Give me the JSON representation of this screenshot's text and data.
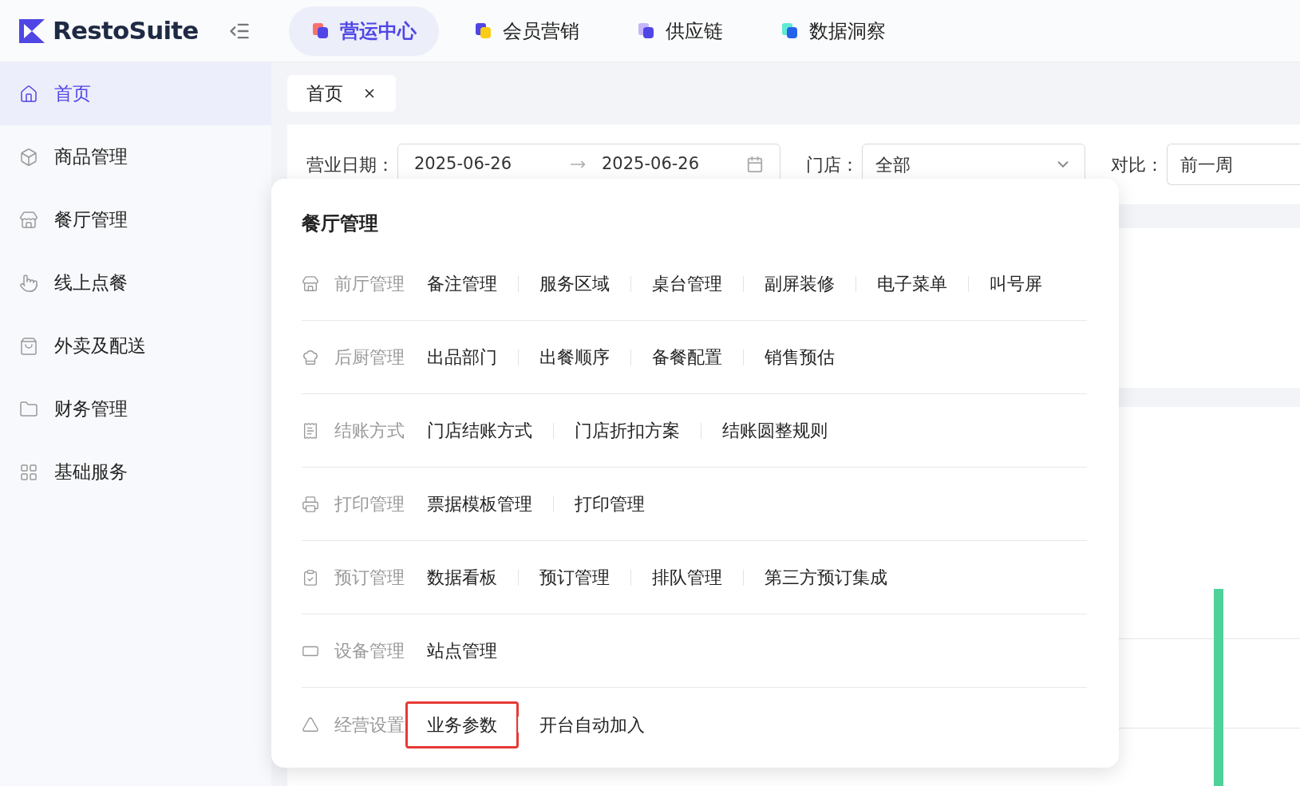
{
  "brand": {
    "name": "RestoSuite"
  },
  "top_nav": [
    {
      "label": "营运中心",
      "selected": true
    },
    {
      "label": "会员营销",
      "selected": false
    },
    {
      "label": "供应链",
      "selected": false
    },
    {
      "label": "数据洞察",
      "selected": false
    }
  ],
  "sidebar": {
    "items": [
      {
        "label": "首页",
        "selected": true
      },
      {
        "label": "商品管理",
        "selected": false
      },
      {
        "label": "餐厅管理",
        "selected": false
      },
      {
        "label": "线上点餐",
        "selected": false
      },
      {
        "label": "外卖及配送",
        "selected": false
      },
      {
        "label": "财务管理",
        "selected": false
      },
      {
        "label": "基础服务",
        "selected": false
      }
    ]
  },
  "page_tabs": [
    {
      "label": "首页",
      "selected": true
    }
  ],
  "filters": [
    {
      "kind": "daterange",
      "label": "营业日期：",
      "start": "2025-06-26",
      "end": "2025-06-26"
    },
    {
      "kind": "select",
      "label": "门店：",
      "value": "全部"
    },
    {
      "kind": "input",
      "label": "对比：",
      "value": "前一周"
    }
  ],
  "menu": {
    "title": "餐厅管理",
    "groups": [
      {
        "label": "前厅管理",
        "items": [
          {
            "label": "备注管理",
            "highlighted": false
          },
          {
            "label": "服务区域",
            "highlighted": false
          },
          {
            "label": "桌台管理",
            "highlighted": false
          },
          {
            "label": "副屏装修",
            "highlighted": false
          },
          {
            "label": "电子菜单",
            "highlighted": false
          },
          {
            "label": "叫号屏",
            "highlighted": false
          }
        ]
      },
      {
        "label": "后厨管理",
        "items": [
          {
            "label": "出品部门",
            "highlighted": false
          },
          {
            "label": "出餐顺序",
            "highlighted": false
          },
          {
            "label": "备餐配置",
            "highlighted": false
          },
          {
            "label": "销售预估",
            "highlighted": false
          }
        ]
      },
      {
        "label": "结账方式",
        "items": [
          {
            "label": "门店结账方式",
            "highlighted": false
          },
          {
            "label": "门店折扣方案",
            "highlighted": false
          },
          {
            "label": "结账圆整规则",
            "highlighted": false
          }
        ]
      },
      {
        "label": "打印管理",
        "items": [
          {
            "label": "票据模板管理",
            "highlighted": false
          },
          {
            "label": "打印管理",
            "highlighted": false
          }
        ]
      },
      {
        "label": "预订管理",
        "items": [
          {
            "label": "数据看板",
            "highlighted": false
          },
          {
            "label": "预订管理",
            "highlighted": false
          },
          {
            "label": "排队管理",
            "highlighted": false
          },
          {
            "label": "第三方预订集成",
            "highlighted": false
          }
        ]
      },
      {
        "label": "设备管理",
        "items": [
          {
            "label": "站点管理",
            "highlighted": false
          }
        ]
      },
      {
        "label": "经营设置",
        "items": [
          {
            "label": "业务参数",
            "highlighted": true
          },
          {
            "label": "开台自动加入",
            "highlighted": false
          }
        ]
      }
    ]
  }
}
